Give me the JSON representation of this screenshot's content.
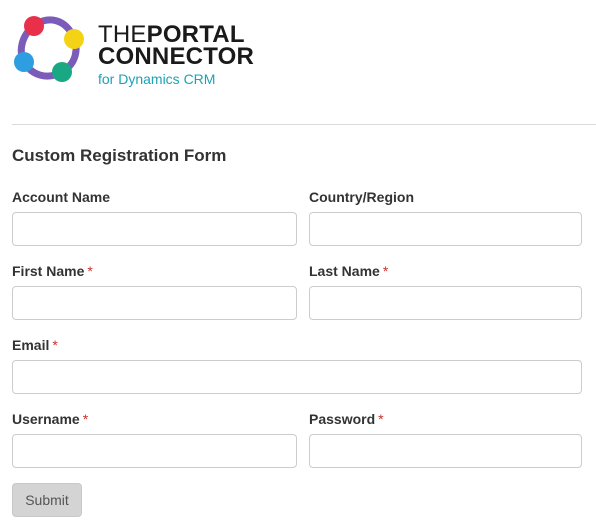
{
  "logo": {
    "line1_a": "THE",
    "line1_b": "PORTAL",
    "line2": "CONNECTOR",
    "line3": "for Dynamics CRM",
    "colors": {
      "red": "#e8304a",
      "yellow": "#f4d316",
      "green": "#1aa884",
      "blue": "#2d9fe0",
      "ring": "#7b5cb8",
      "accent_text": "#1ca3b5"
    }
  },
  "form": {
    "title": "Custom Registration Form",
    "required_marker": "*",
    "fields": {
      "account_name": {
        "label": "Account Name",
        "value": ""
      },
      "country_region": {
        "label": "Country/Region",
        "value": ""
      },
      "first_name": {
        "label": "First Name",
        "value": ""
      },
      "last_name": {
        "label": "Last Name",
        "value": ""
      },
      "email": {
        "label": "Email",
        "value": ""
      },
      "username": {
        "label": "Username",
        "value": ""
      },
      "password": {
        "label": "Password",
        "value": ""
      }
    },
    "submit_label": "Submit"
  }
}
